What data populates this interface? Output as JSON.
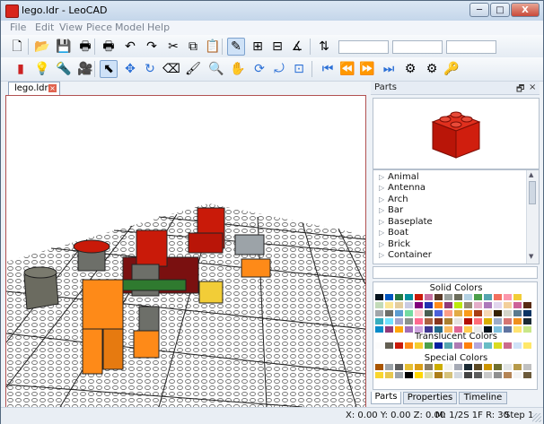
{
  "window": {
    "title": "lego.ldr - LeoCAD"
  },
  "window_controls": {
    "minimize": "─",
    "maximize": "□",
    "close": "X"
  },
  "menu": [
    "File",
    "Edit",
    "View",
    "Piece",
    "Model",
    "Help"
  ],
  "toolbar1": [
    {
      "icon": "new-file-icon",
      "glyph": "🗋"
    },
    {
      "icon": "open-folder-icon",
      "glyph": "📂"
    },
    {
      "icon": "save-icon",
      "glyph": "💾"
    },
    {
      "icon": "print-icon",
      "glyph": "🖶"
    },
    {
      "icon": "print-preview-icon",
      "glyph": "🖶"
    },
    {
      "icon": "undo-icon",
      "glyph": "↶"
    },
    {
      "icon": "redo-icon",
      "glyph": "↷"
    },
    {
      "icon": "cut-icon",
      "glyph": "✂"
    },
    {
      "icon": "copy-icon",
      "glyph": "⧉"
    },
    {
      "icon": "paste-icon",
      "glyph": "📋"
    },
    {
      "icon": "relative-transform-icon",
      "glyph": "✎"
    },
    {
      "icon": "snap-xy-icon",
      "glyph": "⊞"
    },
    {
      "icon": "snap-z-icon",
      "glyph": "⊟"
    },
    {
      "icon": "angle-snap-icon",
      "glyph": "∡"
    },
    {
      "icon": "lock-toggle-icon",
      "glyph": "⇅"
    }
  ],
  "toolbar1_inputs": 3,
  "toolbar2": [
    {
      "icon": "insert-brick-icon",
      "glyph": "▮",
      "color": "#cc2222"
    },
    {
      "icon": "light-icon",
      "glyph": "💡"
    },
    {
      "icon": "spotlight-icon",
      "glyph": "🔦"
    },
    {
      "icon": "camera-icon",
      "glyph": "🎥"
    },
    {
      "icon": "select-icon",
      "glyph": "⬉"
    },
    {
      "icon": "move-icon",
      "glyph": "✥",
      "color": "#2a6fd6"
    },
    {
      "icon": "rotate-icon",
      "glyph": "↻",
      "color": "#2a6fd6"
    },
    {
      "icon": "eraser-icon",
      "glyph": "⌫"
    },
    {
      "icon": "paint-icon",
      "glyph": "🖌"
    },
    {
      "icon": "zoom-icon",
      "glyph": "🔍"
    },
    {
      "icon": "pan-icon",
      "glyph": "✋"
    },
    {
      "icon": "rotate-view-icon",
      "glyph": "⟳",
      "color": "#2a6fd6"
    },
    {
      "icon": "roll-icon",
      "glyph": "⤾",
      "color": "#2a6fd6"
    },
    {
      "icon": "zoom-region-icon",
      "glyph": "⊡",
      "color": "#2a6fd6"
    },
    {
      "icon": "first-step-icon",
      "glyph": "⏮",
      "color": "#2a6fd6"
    },
    {
      "icon": "previous-step-icon",
      "glyph": "⏪",
      "color": "#2a6fd6"
    },
    {
      "icon": "next-step-icon",
      "glyph": "⏩",
      "color": "#2a6fd6"
    },
    {
      "icon": "last-step-icon",
      "glyph": "⏭",
      "color": "#2a6fd6"
    },
    {
      "icon": "animation-icon",
      "glyph": "⚙"
    },
    {
      "icon": "add-keys-icon",
      "glyph": "⚙"
    },
    {
      "icon": "key-icon",
      "glyph": "🔑",
      "color": "#d3a300"
    }
  ],
  "document_tab": {
    "label": "lego.ldr",
    "close": "×"
  },
  "parts_panel": {
    "title": "Parts",
    "float_glyph": "🗗",
    "close_glyph": "×",
    "categories": [
      "Animal",
      "Antenna",
      "Arch",
      "Bar",
      "Baseplate",
      "Boat",
      "Brick",
      "Container"
    ],
    "solid_label": "Solid Colors",
    "translucent_label": "Translucent Colors",
    "special_label": "Special Colors",
    "solid_colors": [
      "#05131d",
      "#0055bf",
      "#237841",
      "#008f9b",
      "#c91a09",
      "#c870a0",
      "#583927",
      "#9ba19d",
      "#6d6e5c",
      "#b4d2e3",
      "#4b9f4a",
      "#55a5af",
      "#f2705e",
      "#fc97ac",
      "#f2cd37",
      "#ffffff",
      "#c2dab8",
      "#fbe696",
      "#e4cd9e",
      "#c9cae2",
      "#81007b",
      "#2032b0",
      "#fe8a18",
      "#923978",
      "#bbe90b",
      "#958a73",
      "#e4adc8",
      "#ac78ba",
      "#e1d5ed",
      "#f3cf9b",
      "#cd6298",
      "#582a12",
      "#a0a5a9",
      "#6c6e68",
      "#5c9dd1",
      "#73dca1",
      "#fecccf",
      "#4a5e52",
      "#4c61db",
      "#fc9e86",
      "#e2ab45",
      "#fa9c1c",
      "#a83d15",
      "#f6d7b3",
      "#352100",
      "#d4d5c9",
      "#5b7a8e",
      "#0a3463",
      "#36aebf",
      "#72e4ff",
      "#a5a5cb",
      "#8a928d",
      "#ff698f",
      "#ad6140",
      "#89351d",
      "#aa7f2e",
      "#e6e3e0",
      "#b31004",
      "#ff6d77",
      "#dab000",
      "#9babc7",
      "#d67572",
      "#f08f1c",
      "#1b2a34",
      "#078bc9",
      "#923978",
      "#ffa70b",
      "#a06eb9",
      "#cda4de",
      "#3f3691",
      "#226a8a",
      "#f9ba61",
      "#df6695",
      "#ffcc4e",
      "#e8e8e8",
      "#05131d",
      "#7dbfdd",
      "#6074a1",
      "#ffe371",
      "#c9e788"
    ],
    "translucent_colors": [
      "#fcfcfc",
      "#635f52",
      "#c91a09",
      "#fe8a18",
      "#f5cd2f",
      "#4b9f4a",
      "#0020a0",
      "#55a5af",
      "#ae7ab3",
      "#ff800d",
      "#b4a6dc",
      "#68bcc5",
      "#dadc20",
      "#cb6c8c",
      "#cfe2f7",
      "#ffe86a",
      "#c7d23c",
      "#a5a5cb",
      "#fcb76d",
      "#ff9ac0",
      "#9c9c9c",
      "#3cb371",
      "#df6695",
      "#cccccc",
      "#f9f9f9",
      "#ededed",
      "#a3b8d6",
      "#dddddd",
      "#aaaaaa",
      "#ffffff",
      "#f2f2f2",
      "#e8e8e8"
    ],
    "special_colors": [
      "#a95500",
      "#9ca3a8",
      "#5d5d5d",
      "#e6be33",
      "#db9e18",
      "#8a7d64",
      "#ccad00",
      "#f2f3f2",
      "#a5a9b4",
      "#1b2a34",
      "#5c4a25",
      "#cc9500",
      "#6f6f2e",
      "#e2e5e5",
      "#b69a4a",
      "#c0c0c0",
      "#f9d62e",
      "#e7c84e",
      "#9ca3a8",
      "#000000",
      "#ffd700",
      "#ddddaa",
      "#ac7e17",
      "#d5c27c",
      "#d2d8df",
      "#434343",
      "#5b5b5b",
      "#c8c8c8",
      "#8f8f8f",
      "#b48455",
      "#f3f3f3",
      "#6b5a3a"
    ],
    "tabs": [
      "Parts",
      "Properties",
      "Timeline"
    ]
  },
  "status": {
    "coords": "X: 0.00 Y: 0.00 Z: 0.00",
    "matrix": "M: 1/2S 1F R: 30",
    "step": "Step 1"
  }
}
